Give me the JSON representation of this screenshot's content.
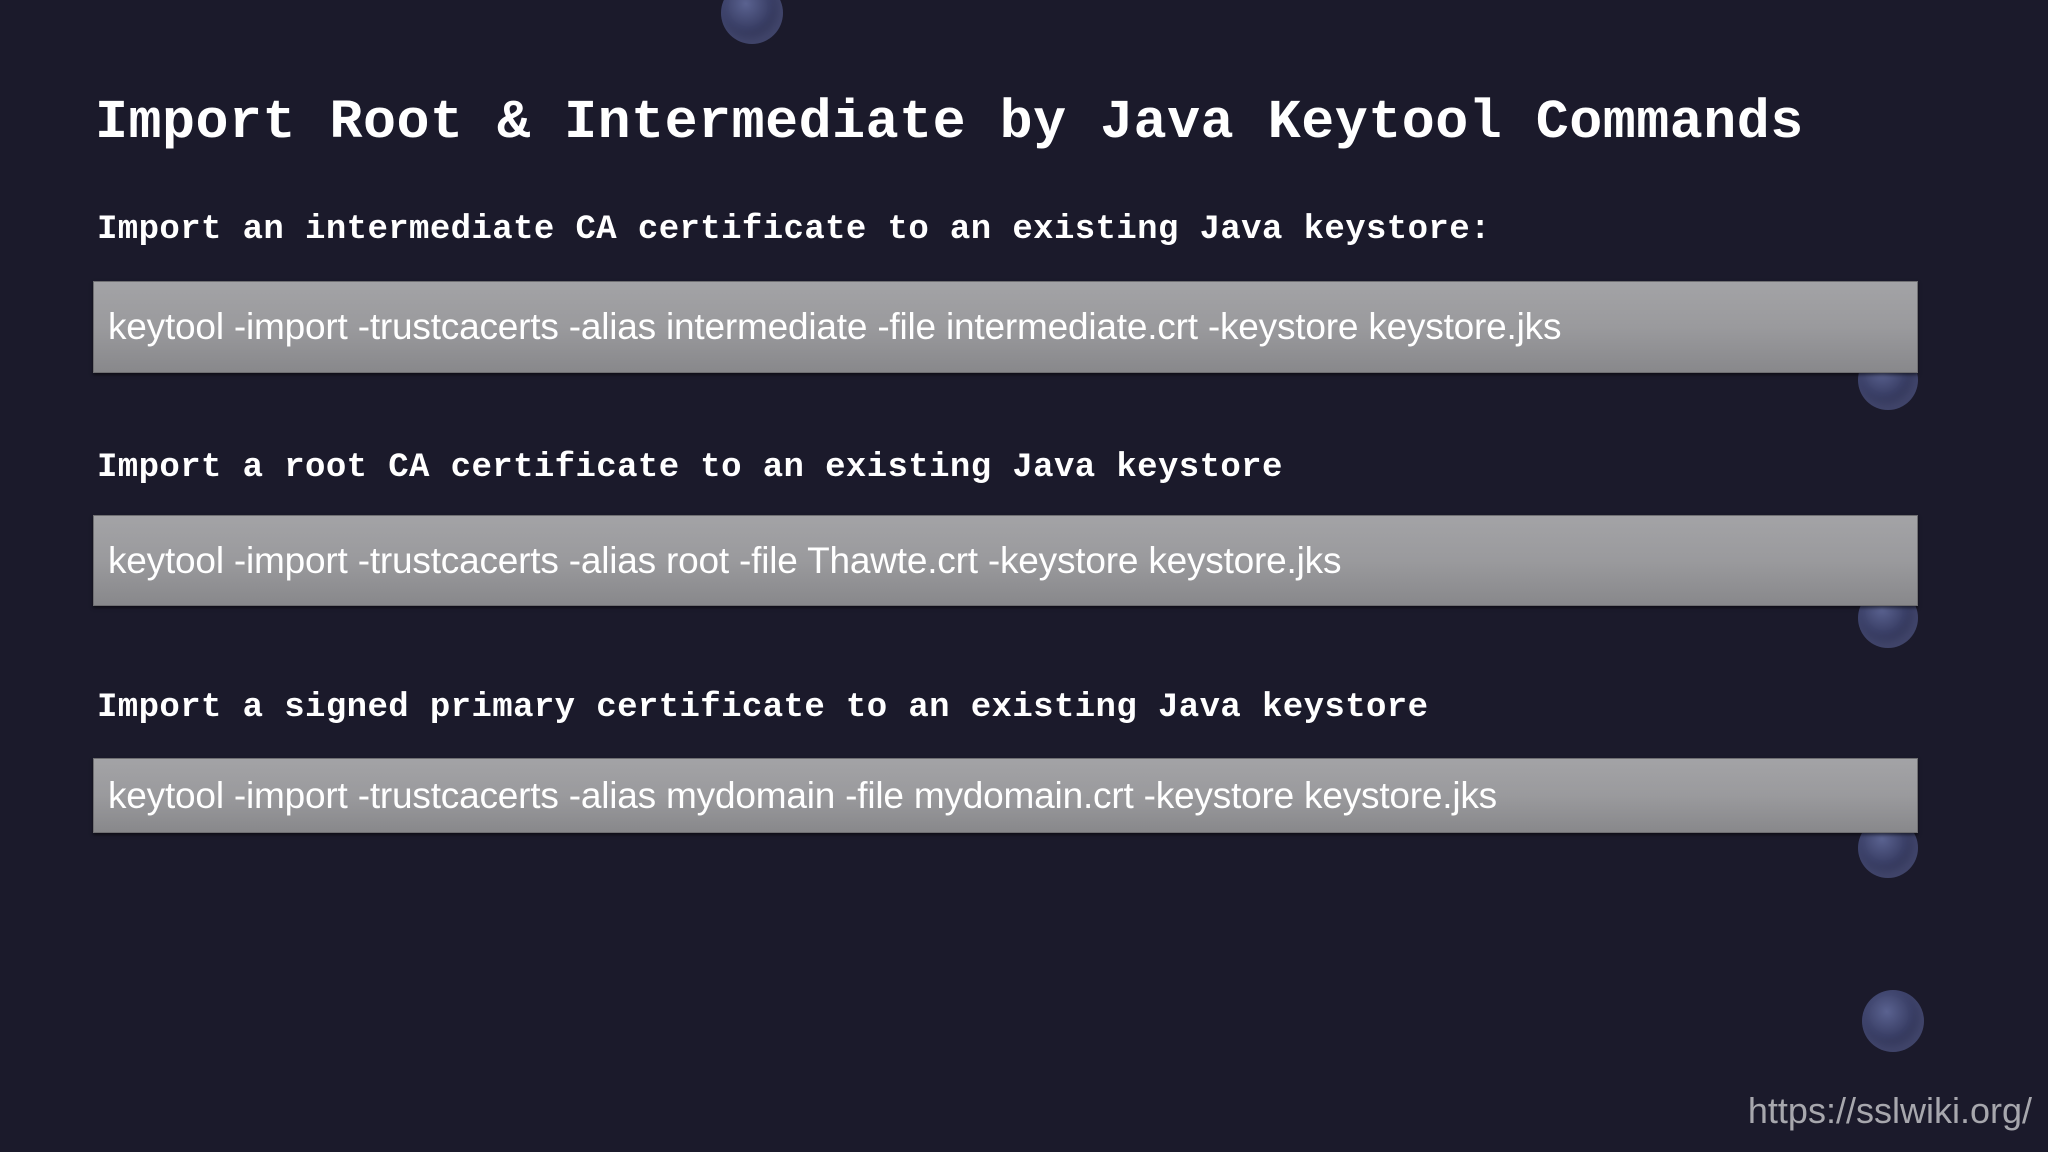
{
  "slide": {
    "title": "Import Root & Intermediate by Java Keytool Commands",
    "sections": [
      {
        "label": "Import an intermediate CA certificate to an existing Java keystore:",
        "command": "keytool -import -trustcacerts -alias intermediate -file intermediate.crt -keystore keystore.jks"
      },
      {
        "label": "Import a root CA certificate to an existing Java keystore",
        "command": "keytool -import -trustcacerts -alias root -file Thawte.crt -keystore keystore.jks"
      },
      {
        "label": "Import a signed primary certificate to an existing Java keystore",
        "command": "keytool -import -trustcacerts -alias mydomain -file mydomain.crt -keystore keystore.jks"
      }
    ],
    "footer_url": "https://sslwiki.org/"
  },
  "colors": {
    "background": "#1b1a2b",
    "text": "#ffffff",
    "command_box": "#9a9a9d",
    "footer_text": "#a7a7ad"
  }
}
